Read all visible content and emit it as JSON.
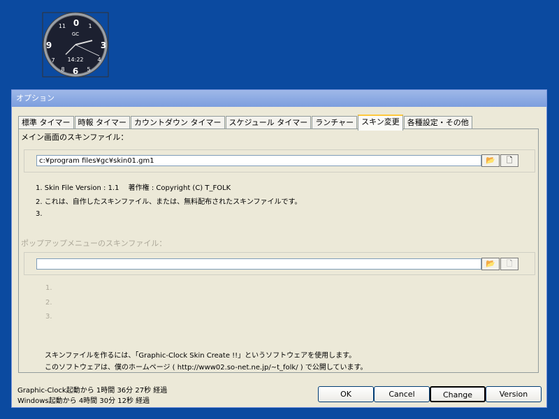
{
  "clock": {
    "brand": "GC",
    "numbers": [
      "0",
      "11",
      "1",
      "9",
      "3",
      "7",
      "5",
      "6",
      "8",
      "4"
    ],
    "digital_time": "14:22"
  },
  "window": {
    "title": "オプション"
  },
  "tabs": [
    {
      "label": "標準 タイマー"
    },
    {
      "label": "時報 タイマー"
    },
    {
      "label": "カウントダウン タイマー"
    },
    {
      "label": "スケジュール タイマー"
    },
    {
      "label": "ランチャー"
    },
    {
      "label": "スキン変更",
      "active": true
    },
    {
      "label": "各種設定・その他"
    }
  ],
  "main_skin": {
    "label": "メイン画面のスキンファイル：",
    "path": "c:¥program files¥gc¥skin01.gm1",
    "info": [
      "1. Skin File Version : 1.1　 著作権 : Copyright (C) T_FOLK",
      "2. これは、自作したスキンファイル、または、無料配布されたスキンファイルです。",
      "3."
    ]
  },
  "popup_skin": {
    "label": "ポップアップメニューのスキンファイル：",
    "path": "",
    "info": [
      "1.",
      "2.",
      "3."
    ]
  },
  "note": [
    "スキンファイルを作るには、「Graphic-Clock Skin Create !!」というソフトウェアを使用します。",
    "このソフトウェアは、僕のホームページ ( http://www02.so-net.ne.jp/~t_folk/ ) で公開しています。"
  ],
  "status": [
    "Graphic-Clock起動から 1時間 36分 27秒 経過",
    "Windows起動から 4時間 30分 12秒 経過"
  ],
  "buttons": {
    "ok": "OK",
    "cancel": "Cancel",
    "change": "Change",
    "version": "Version"
  }
}
